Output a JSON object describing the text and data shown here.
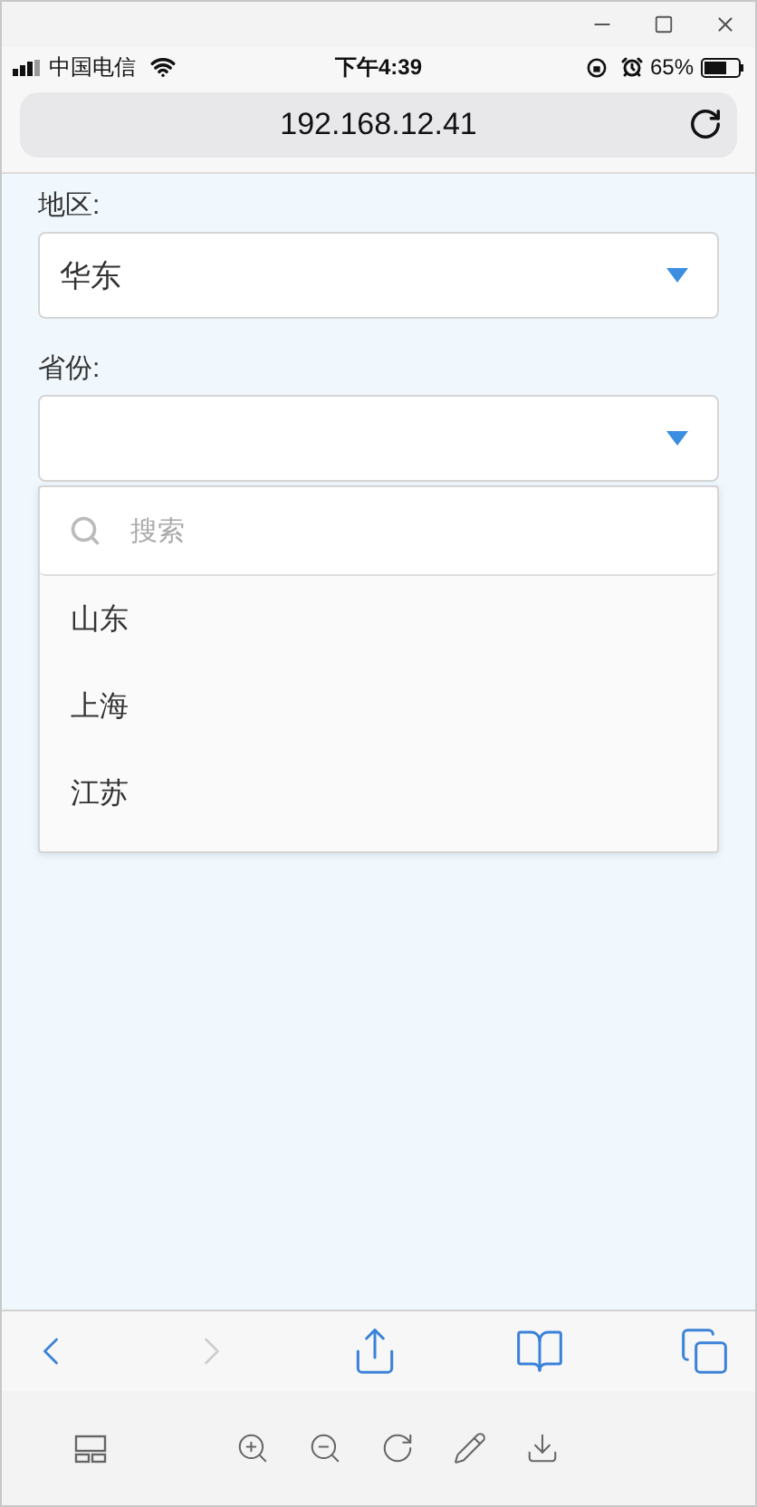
{
  "status_bar": {
    "carrier": "中国电信",
    "time": "下午4:39",
    "battery": "65%"
  },
  "address_bar": {
    "url": "192.168.12.41"
  },
  "form": {
    "fields": [
      {
        "label": "地区:",
        "value": "华东"
      },
      {
        "label": "省份:",
        "dropdown": {
          "search_placeholder": "搜索",
          "options": [
            "山东",
            "上海",
            "江苏"
          ]
        }
      }
    ]
  },
  "toolbar": [
    {
      "kind": "back",
      "disabled": false
    },
    {
      "kind": "forward",
      "disabled": true
    },
    {
      "kind": "share",
      "disabled": false
    },
    {
      "kind": "bookmarks",
      "disabled": false
    },
    {
      "kind": "tabs",
      "disabled": false
    }
  ],
  "tools": [
    {
      "kind": "layout"
    },
    {
      "kind": "zoom-in"
    },
    {
      "kind": "zoom-out"
    },
    {
      "kind": "rotate"
    },
    {
      "kind": "edit"
    },
    {
      "kind": "download"
    }
  ]
}
